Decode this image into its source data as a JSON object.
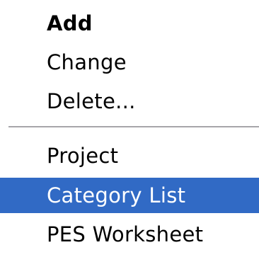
{
  "menu": {
    "items_top": [
      {
        "label": "Add",
        "selected": false
      },
      {
        "label": "Change",
        "selected": false
      },
      {
        "label": "Delete...",
        "selected": false
      }
    ],
    "items_bottom": [
      {
        "label": "Project",
        "selected": false
      },
      {
        "label": "Category List",
        "selected": true
      },
      {
        "label": "PES Worksheet",
        "selected": false
      }
    ],
    "colors": {
      "selection_background": "#316ac5",
      "selection_text": "#ffffff",
      "separator": "#a7a6aa"
    }
  }
}
